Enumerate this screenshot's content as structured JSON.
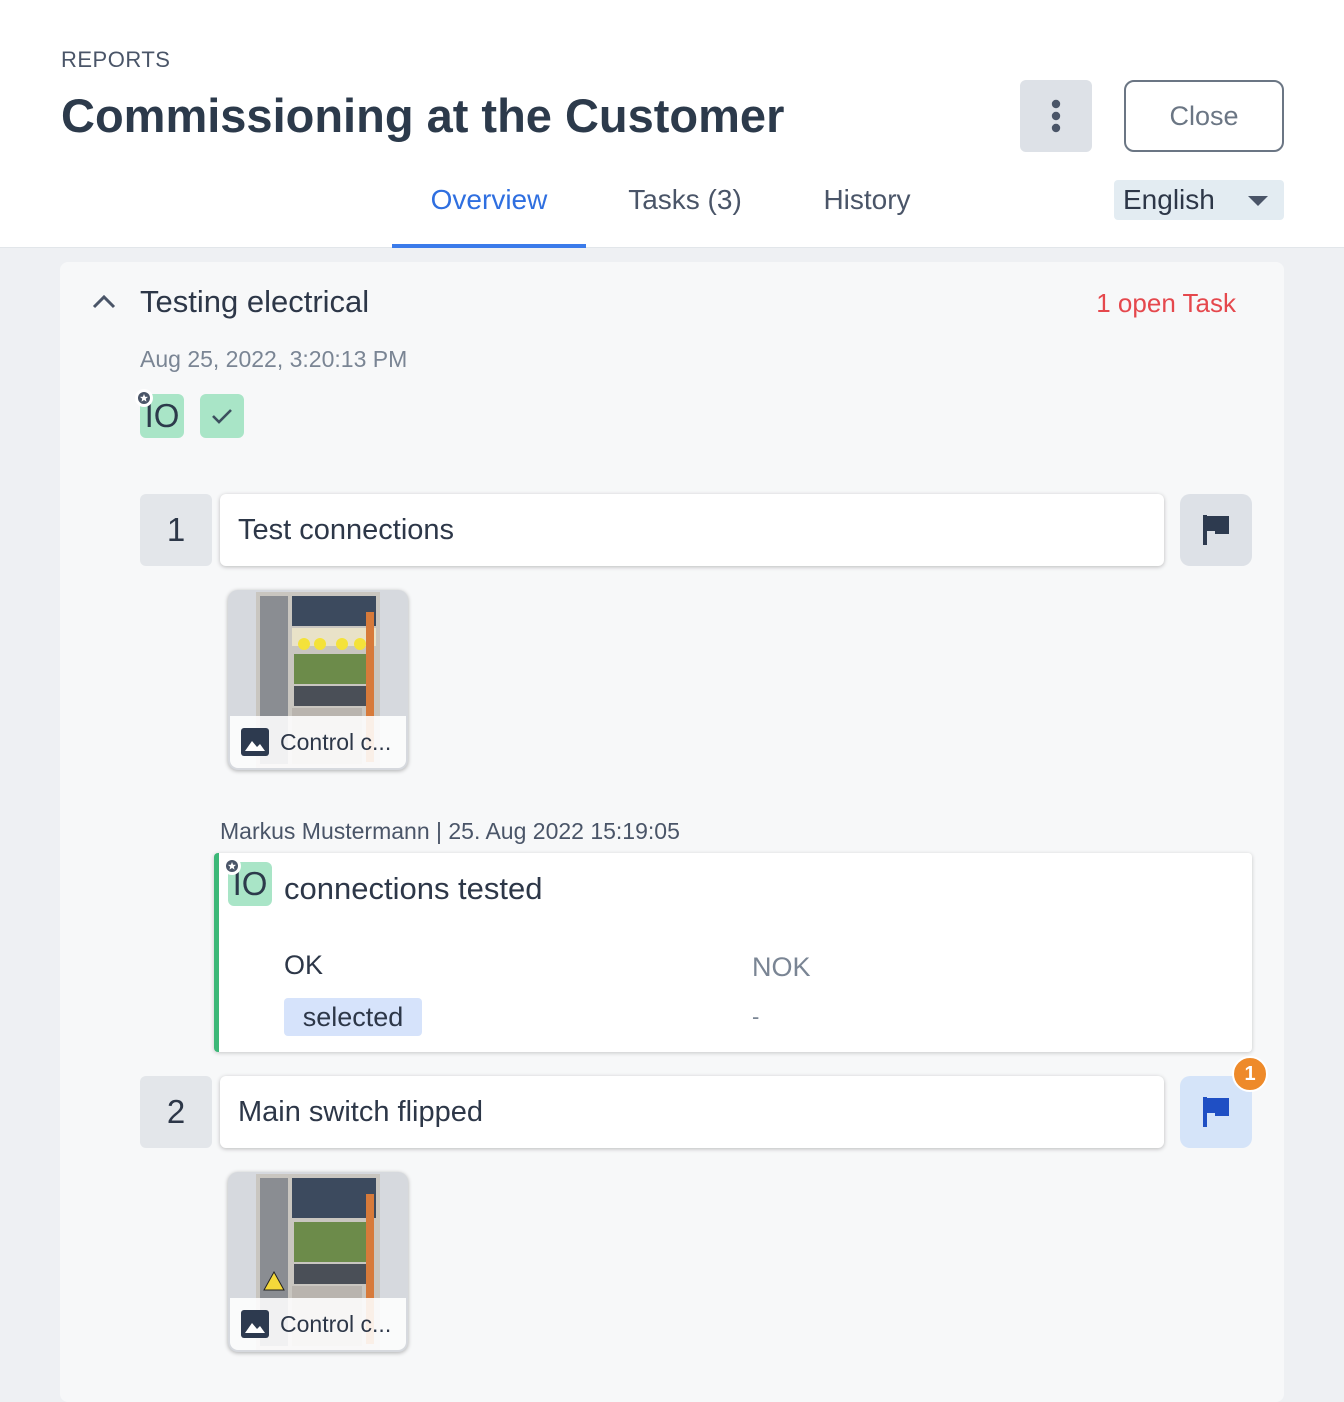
{
  "header": {
    "breadcrumb": "REPORTS",
    "title": "Commissioning at the Customer",
    "close_label": "Close",
    "more_icon": "more-vertical-icon",
    "language": "English"
  },
  "tabs": [
    {
      "label": "Overview",
      "active": true
    },
    {
      "label": "Tasks (3)",
      "active": false
    },
    {
      "label": "History",
      "active": false
    }
  ],
  "section": {
    "title": "Testing electrical",
    "open_tasks": "1 open Task",
    "date": "Aug 25, 2022, 3:20:13 PM",
    "io_label": "IO"
  },
  "tasks": [
    {
      "number": "1",
      "label": "Test connections",
      "attachment_caption": "Control c...",
      "flag_icon": "flag-icon"
    },
    {
      "number": "2",
      "label": "Main switch flipped",
      "attachment_caption": "Control c...",
      "flag_icon": "flag-icon",
      "flag_badge": "1"
    }
  ],
  "result": {
    "author": "Markus Mustermann | 25. Aug 2022 15:19:05",
    "io_label": "IO",
    "title": "connections tested",
    "ok_label": "OK",
    "nok_label": "NOK",
    "ok_value": "selected",
    "nok_value": "-"
  },
  "colors": {
    "accent": "#3b7bea",
    "danger": "#e5484d",
    "success": "#3cb878",
    "badge": "#ee8a2a"
  }
}
